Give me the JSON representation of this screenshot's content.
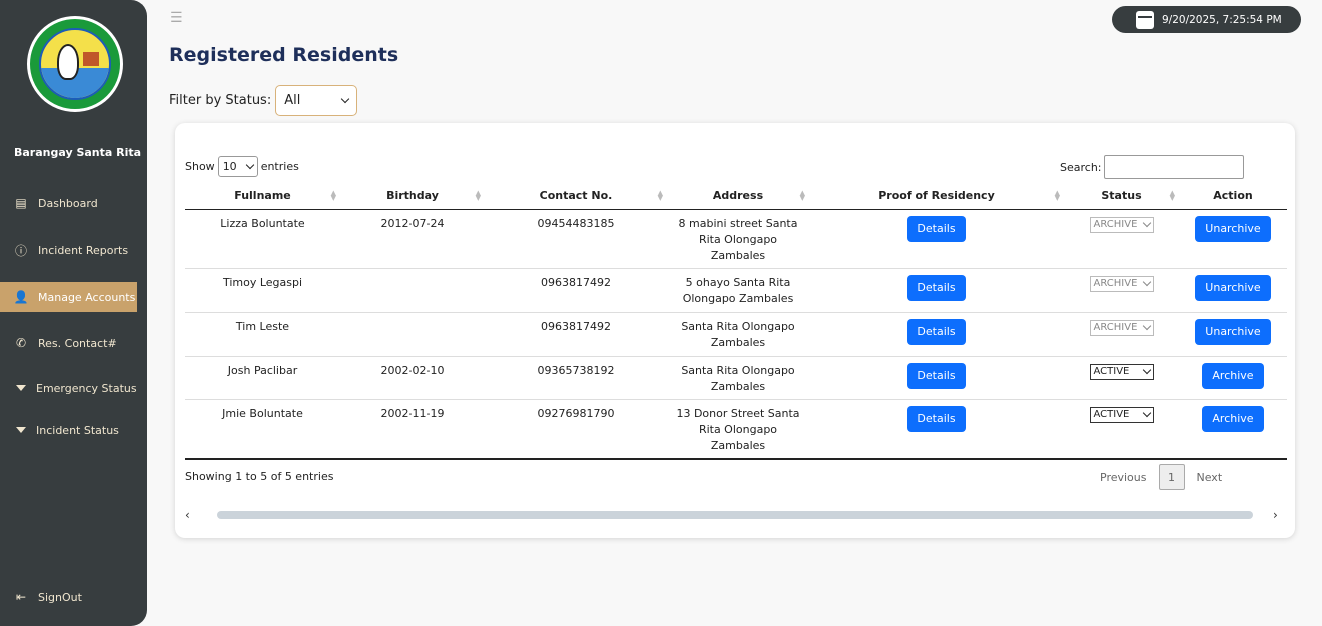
{
  "sidebar": {
    "brand": "Barangay Santa Rita",
    "items": [
      {
        "label": "Dashboard",
        "icon": "clipboard-icon"
      },
      {
        "label": "Incident Reports",
        "icon": "alert-icon"
      },
      {
        "label": "Manage Accounts",
        "icon": "user-gear-icon"
      },
      {
        "label": "Res. Contact#",
        "icon": "phone-icon"
      },
      {
        "label": "Emergency Status",
        "icon": "caret-down-icon"
      },
      {
        "label": "Incident Status",
        "icon": "caret-down-icon"
      }
    ],
    "signout": "SignOut",
    "active_color": "#c9a26b"
  },
  "header": {
    "datetime": "9/20/2025, 7:25:54 PM"
  },
  "page": {
    "title": "Registered Residents",
    "filter_label": "Filter by Status:",
    "filter_value": "All"
  },
  "table_controls": {
    "show_label": "Show",
    "show_value": "10",
    "entries_label": "entries",
    "search_label": "Search:"
  },
  "table": {
    "columns": [
      "Fullname",
      "Birthday",
      "Contact No.",
      "Address",
      "Proof of Residency",
      "Status",
      "Action"
    ],
    "rows": [
      {
        "fullname": "Lizza Boluntate",
        "birthday": "2012-07-24",
        "contact": "09454483185",
        "address": [
          "8 mabini street Santa",
          "Rita Olongapo",
          "Zambales"
        ],
        "proof": "Details",
        "status": "ARCHIVE",
        "action": "Unarchive"
      },
      {
        "fullname": "Timoy Legaspi",
        "birthday": "",
        "contact": "0963817492",
        "address": [
          "5 ohayo Santa Rita",
          "Olongapo Zambales"
        ],
        "proof": "Details",
        "status": "ARCHIVE",
        "action": "Unarchive"
      },
      {
        "fullname": "Tim Leste",
        "birthday": "",
        "contact": "0963817492",
        "address": [
          "Santa Rita Olongapo",
          "Zambales"
        ],
        "proof": "Details",
        "status": "ARCHIVE",
        "action": "Unarchive"
      },
      {
        "fullname": "Josh Paclibar",
        "birthday": "2002-02-10",
        "contact": "09365738192",
        "address": [
          "Santa Rita Olongapo",
          "Zambales"
        ],
        "proof": "Details",
        "status": "ACTIVE",
        "action": "Archive"
      },
      {
        "fullname": "Jmie Boluntate",
        "birthday": "2002-11-19",
        "contact": "09276981790",
        "address": [
          "13 Donor Street Santa",
          "Rita Olongapo",
          "Zambales"
        ],
        "proof": "Details",
        "status": "ACTIVE",
        "action": "Archive"
      }
    ]
  },
  "footer": {
    "info": "Showing 1 to 5 of 5 entries",
    "previous": "Previous",
    "page": "1",
    "next": "Next"
  }
}
